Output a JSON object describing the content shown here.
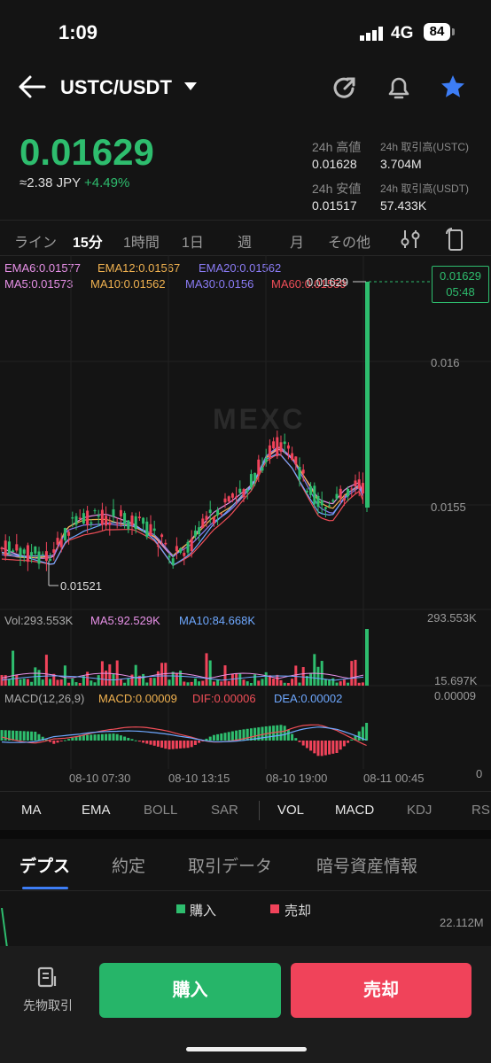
{
  "status_bar": {
    "time": "1:09",
    "network": "4G",
    "battery": "84"
  },
  "header": {
    "pair": "USTC/USDT"
  },
  "price": {
    "last": "0.01629",
    "jpy": "≈2.38 JPY",
    "change": "+4.49%",
    "high_label": "24h 高値",
    "high": "0.01628",
    "low_label": "24h 安値",
    "low": "0.01517",
    "vol_ustc_label": "24h 取引高(USTC)",
    "vol_ustc": "3.704M",
    "vol_usdt_label": "24h 取引高(USDT)",
    "vol_usdt": "57.433K"
  },
  "timeframes": [
    "ライン",
    "15分",
    "1時間",
    "1日",
    "週",
    "月",
    "その他"
  ],
  "overlay": {
    "ema6": "EMA6:0.01577",
    "ema12": "EMA12:0.01567",
    "ema20": "EMA20:0.01562",
    "ma5": "MA5:0.01573",
    "ma10": "MA10:0.01562",
    "ma30": "MA30:0.0156",
    "ma60": "MA60:0.01559",
    "max_label": "0.01629",
    "min_label": "0.01521",
    "price_tag": "0.01629",
    "countdown": "05:48",
    "y_ticks": [
      "0.016",
      "0.0155"
    ],
    "watermark": "MEXC"
  },
  "volume": {
    "vol": "Vol:293.553K",
    "ma5": "MA5:92.529K",
    "ma10": "MA10:84.668K",
    "top": "293.553K",
    "bottom": "15.697K"
  },
  "macd": {
    "label": "MACD(12,26,9)",
    "macd": "MACD:0.00009",
    "dif": "DIF:0.00006",
    "dea": "DEA:0.00002",
    "top": "0.00009",
    "bottom": "0"
  },
  "x_labels": [
    "08-10 07:30",
    "08-10 13:15",
    "08-10 19:00",
    "08-11 00:45"
  ],
  "indicators": [
    "MA",
    "EMA",
    "BOLL",
    "SAR",
    "VOL",
    "MACD",
    "KDJ",
    "RS"
  ],
  "bottom_tabs": [
    "デプス",
    "約定",
    "取引データ",
    "暗号資産情報"
  ],
  "depth": {
    "buy": "購入",
    "sell": "売却",
    "value": "22.112M"
  },
  "footer": {
    "futures": "先物取引",
    "buy": "購入",
    "sell": "売却"
  },
  "colors": {
    "up": "#2ebd6e",
    "down": "#f0435a",
    "bg": "#141414"
  }
}
